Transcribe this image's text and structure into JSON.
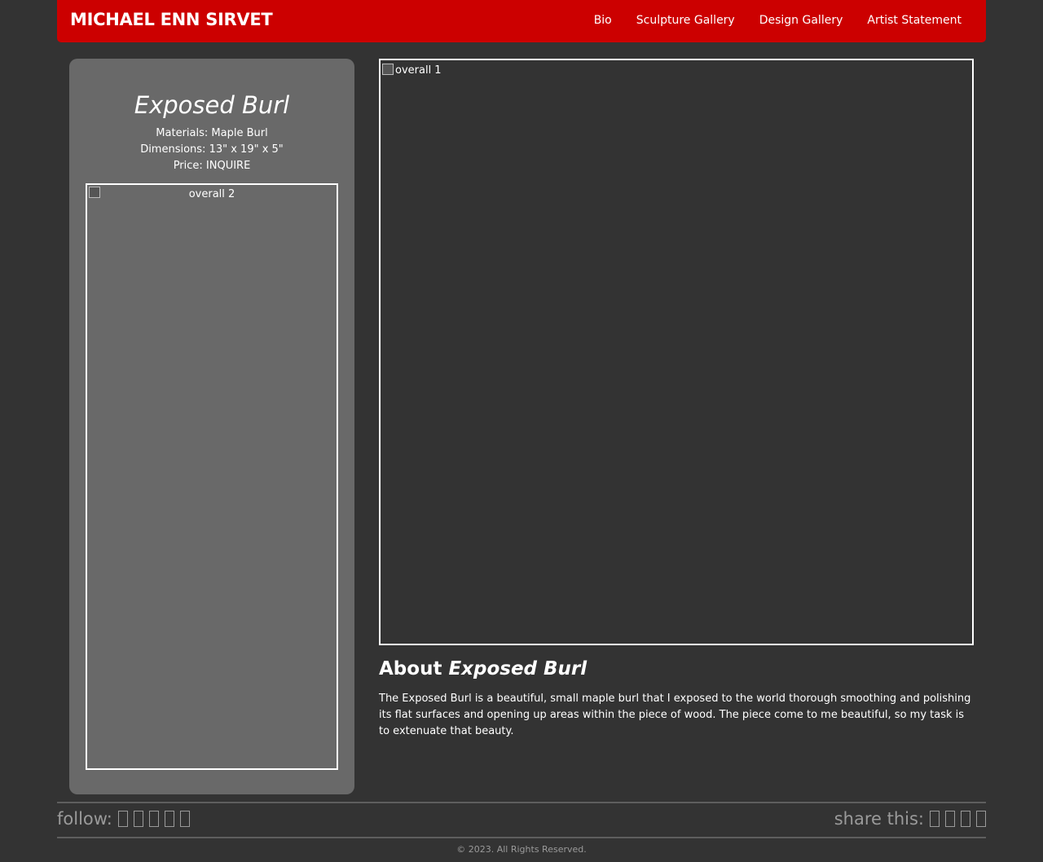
{
  "header": {
    "brand": "MICHAEL ENN SIRVET",
    "nav": [
      "Bio",
      "Sculpture Gallery",
      "Design Gallery",
      "Artist Statement"
    ],
    "background_color": "#cc0000"
  },
  "sidebar": {
    "title": "Exposed Burl",
    "materials": "Materials: Maple Burl",
    "dimensions": "Dimensions: 13\" x 19\" x 5\"",
    "price": "Price: INQUIRE",
    "image_alt": "overall 2"
  },
  "main": {
    "image_alt": "overall 1",
    "about_prefix": "About",
    "about_title": "Exposed Burl",
    "about_text": "The Exposed Burl is a beautiful, small maple burl that I exposed to the world thorough smoothing and polishing its flat surfaces and opening up areas within the piece of wood. The piece come to me beautiful, so my task is to extenuate that beauty."
  },
  "footer": {
    "follow_label": "follow:",
    "follow_icons": [
      "social-icon",
      "social-icon",
      "social-icon",
      "social-icon",
      "social-icon"
    ],
    "share_label": "share this:",
    "share_icons": [
      "social-icon",
      "social-icon",
      "social-icon",
      "social-icon"
    ],
    "copyright": "© 2023. All Rights Reserved."
  }
}
